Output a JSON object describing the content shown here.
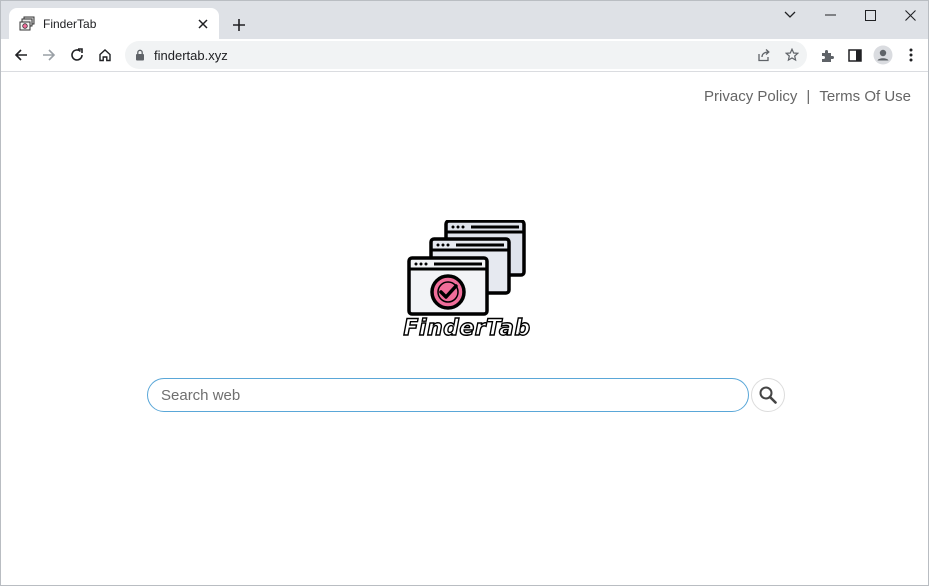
{
  "browser": {
    "tab_title": "FinderTab",
    "url": "findertab.xyz",
    "icons": [
      "back-icon",
      "forward-icon",
      "reload-icon",
      "home-icon",
      "lock-icon",
      "share-icon",
      "star-icon",
      "extensions-icon",
      "side-panel-icon",
      "profile-icon",
      "menu-icon",
      "minimize-icon",
      "maximize-icon",
      "close-icon",
      "chevron-down-icon",
      "new-tab-icon"
    ]
  },
  "page": {
    "links": {
      "privacy": "Privacy Policy",
      "separator": "|",
      "terms": "Terms Of Use"
    },
    "brand": "FinderTab",
    "search": {
      "placeholder": "Search web",
      "value": ""
    }
  },
  "colors": {
    "accent": "#5aa7d8",
    "logo_check": "#f06d9a",
    "tabstrip": "#dee1e6"
  }
}
